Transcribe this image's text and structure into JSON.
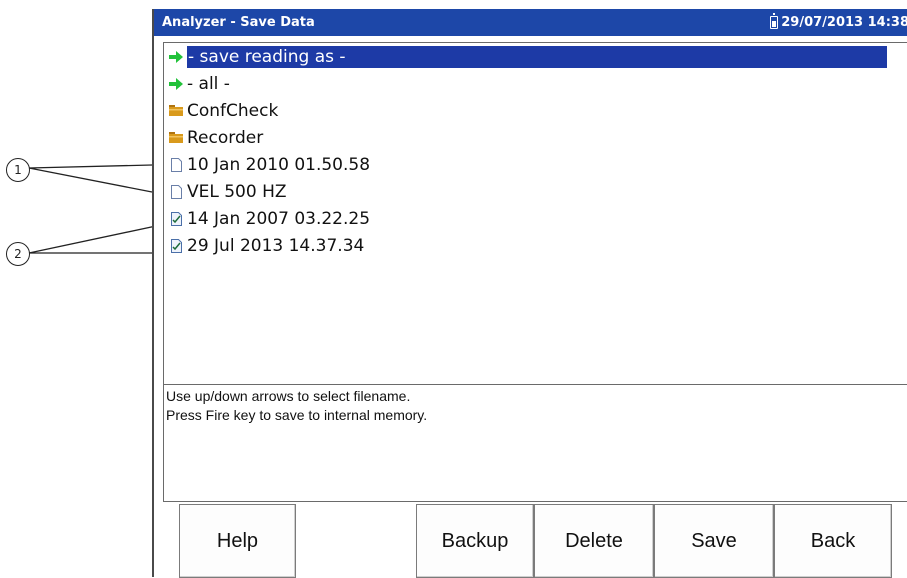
{
  "window": {
    "title": "Analyzer - Save Data",
    "datetime": "29/07/2013 14:38",
    "battery_icon": "battery-icon"
  },
  "callouts": [
    "1",
    "2"
  ],
  "file_list": {
    "items": [
      {
        "label": "- save reading as -",
        "icon": "green-arrow-icon",
        "selected": true
      },
      {
        "label": "- all -",
        "icon": "green-arrow-icon"
      },
      {
        "label": "ConfCheck",
        "icon": "folder-icon"
      },
      {
        "label": "Recorder",
        "icon": "folder-icon"
      },
      {
        "label": "10 Jan 2010 01.50.58",
        "icon": "file-icon"
      },
      {
        "label": "VEL 500 HZ",
        "icon": "file-icon"
      },
      {
        "label": "14 Jan 2007 03.22.25",
        "icon": "checked-file-icon"
      },
      {
        "label": "29 Jul 2013 14.37.34",
        "icon": "checked-file-icon"
      }
    ]
  },
  "info": {
    "line1": "Use up/down arrows to select filename.",
    "line2": "Press Fire key to save to internal memory."
  },
  "softkeys": {
    "help": "Help",
    "backup": "Backup",
    "delete": "Delete",
    "save": "Save",
    "back": "Back"
  },
  "colors": {
    "titlebar": "#1d47a8",
    "selection": "#1d3aa6",
    "arrow": "#22c23a",
    "folder": "#d99a1c"
  }
}
